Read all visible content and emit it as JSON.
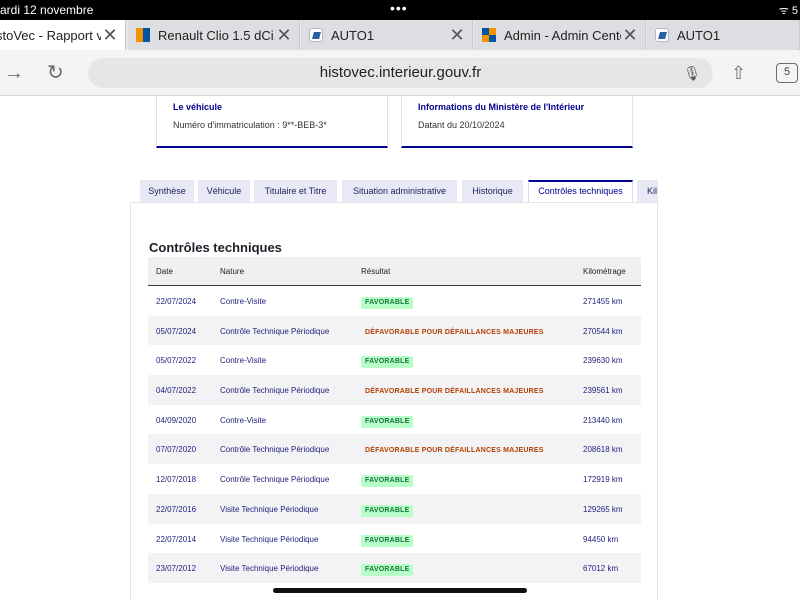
{
  "status_bar": {
    "time": "ardi 12 novembre",
    "right": "ᯤ  5"
  },
  "browser_tabs": [
    {
      "title": "stoVec - Rapport ve",
      "icon": "histovec-icon",
      "active": true
    },
    {
      "title": "Renault Clio 1.5 dCi, 2",
      "icon": "renault-icon",
      "active": false
    },
    {
      "title": "AUTO1",
      "icon": "auto1-icon",
      "active": false
    },
    {
      "title": "Admin - Admin Center",
      "icon": "admin-icon",
      "active": false
    },
    {
      "title": "AUTO1",
      "icon": "auto1-icon",
      "active": false
    }
  ],
  "toolbar": {
    "url": "histovec.interieur.gouv.fr",
    "tab_count": "5"
  },
  "cards": [
    {
      "title": "Le véhicule",
      "text": "Numéro d'immatriculation : 9**-BEB-3*"
    },
    {
      "title": "Informations du Ministère de l'Intérieur",
      "text": "Datant du 20/10/2024"
    }
  ],
  "page_tabs": [
    {
      "label": "Synthèse",
      "active": false
    },
    {
      "label": "Véhicule",
      "active": false
    },
    {
      "label": "Titulaire et Titre",
      "active": false
    },
    {
      "label": "Situation administrative",
      "active": false
    },
    {
      "label": "Historique",
      "active": false
    },
    {
      "label": "Contrôles techniques",
      "active": true
    },
    {
      "label": "Kil",
      "active": false
    }
  ],
  "section_title": "Contrôles techniques",
  "table": {
    "headers": [
      "Date",
      "Nature",
      "Résultat",
      "Kilométrage"
    ],
    "rows": [
      {
        "date": "22/07/2024",
        "nature": "Contre-Visite",
        "result": "FAVORABLE",
        "ok": true,
        "km": "271455 km"
      },
      {
        "date": "05/07/2024",
        "nature": "Contrôle Technique Périodique",
        "result": "DÉFAVORABLE POUR DÉFAILLANCES MAJEURES",
        "ok": false,
        "km": "270544 km"
      },
      {
        "date": "05/07/2022",
        "nature": "Contre-Visite",
        "result": "FAVORABLE",
        "ok": true,
        "km": "239630 km"
      },
      {
        "date": "04/07/2022",
        "nature": "Contrôle Technique Périodique",
        "result": "DÉFAVORABLE POUR DÉFAILLANCES MAJEURES",
        "ok": false,
        "km": "239561 km"
      },
      {
        "date": "04/09/2020",
        "nature": "Contre-Visite",
        "result": "FAVORABLE",
        "ok": true,
        "km": "213440 km"
      },
      {
        "date": "07/07/2020",
        "nature": "Contrôle Technique Périodique",
        "result": "DÉFAVORABLE POUR DÉFAILLANCES MAJEURES",
        "ok": false,
        "km": "208618 km"
      },
      {
        "date": "12/07/2018",
        "nature": "Contrôle Technique Périodique",
        "result": "FAVORABLE",
        "ok": true,
        "km": "172919 km"
      },
      {
        "date": "22/07/2016",
        "nature": "Visite Technique Périodique",
        "result": "FAVORABLE",
        "ok": true,
        "km": "129265 km"
      },
      {
        "date": "22/07/2014",
        "nature": "Visite Technique Périodique",
        "result": "FAVORABLE",
        "ok": true,
        "km": "94450 km"
      },
      {
        "date": "23/07/2012",
        "nature": "Visite Technique Périodique",
        "result": "FAVORABLE",
        "ok": true,
        "km": "67012 km"
      }
    ]
  },
  "colors": {
    "primary": "#000091",
    "favorable_bg": "#b8fec9",
    "favorable_text": "#18753c",
    "defavorable_text": "#b34000"
  }
}
